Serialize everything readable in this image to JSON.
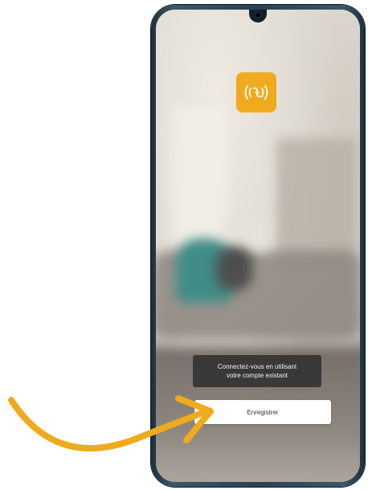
{
  "screen": {
    "app_logo_icon": "wifi-signal-logo-icon",
    "accent_color": "#f0aa1e",
    "login_prompt": {
      "line1": "Connectez-vous en utilisant",
      "line2": "votre compte existant"
    },
    "register_button_label": "Enregistrer"
  },
  "annotation": {
    "arrow_icon": "curved-arrow-icon",
    "arrow_color": "#f0aa1e"
  }
}
